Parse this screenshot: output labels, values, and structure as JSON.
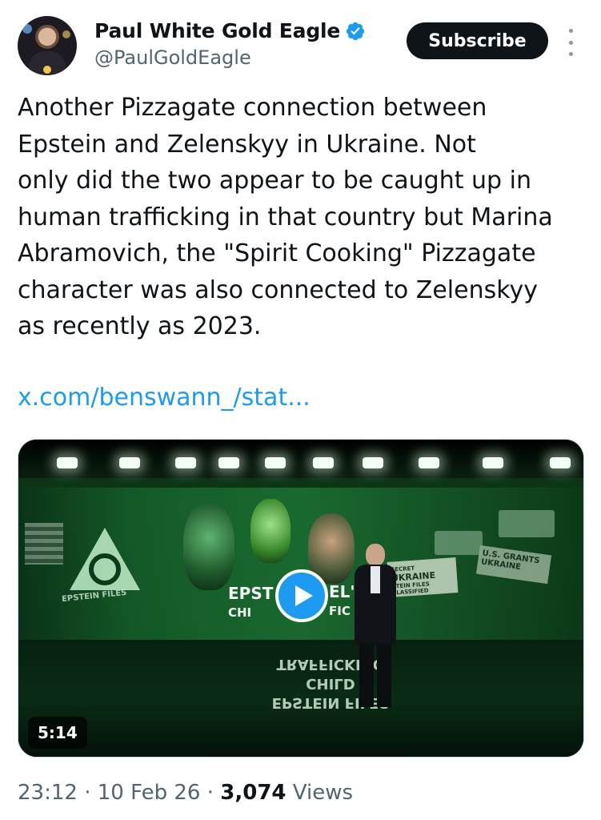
{
  "post": {
    "author": {
      "display_name": "Paul White Gold Eagle",
      "handle": "@PaulGoldEagle",
      "verified": true,
      "avatar_icon": "user-avatar"
    },
    "subscribe_label": "Subscribe",
    "more_icon": "more-vertical-icon",
    "text": "Another Pizzagate connection between\nEpstein and Zelenskyy in Ukraine. Not\nonly did the two appear to be caught up in\nhuman trafficking in that country but Marina\nAbramovich, the \"Spirit Cooking\" Pizzagate\ncharacter was also connected to Zelenskyy\nas recently as 2023.",
    "link": "x.com/benswann_/stat...",
    "media": {
      "type": "video",
      "duration": "5:14",
      "play_icon": "play-icon",
      "visible_text": {
        "panel_left": "EPSTEIN FILES",
        "caption_line1": "EPST",
        "caption_line2": "CHI",
        "caption_right1": "EL'",
        "caption_right2": "FIC",
        "tag_ukraine_top": "SECRET",
        "tag_ukraine": "UKRAINE",
        "tag_ukraine_sub": "STEIN FILES CLASSIFIED",
        "tag_grants": "U.S. GRANTS UKRAINE",
        "reflection_line1": "CHILD TRAFFICKING",
        "reflection_line2": "EPSTEIN FILES"
      }
    },
    "meta": {
      "time": "23:12",
      "separator": "·",
      "date": "10 Feb 26",
      "views_count": "3,074",
      "views_label": "Views"
    },
    "colors": {
      "link": "#1d9bf0",
      "verified_badge": "#1d9bf0",
      "subscribe_bg": "#0f1419",
      "secondary_text": "#536471"
    }
  }
}
